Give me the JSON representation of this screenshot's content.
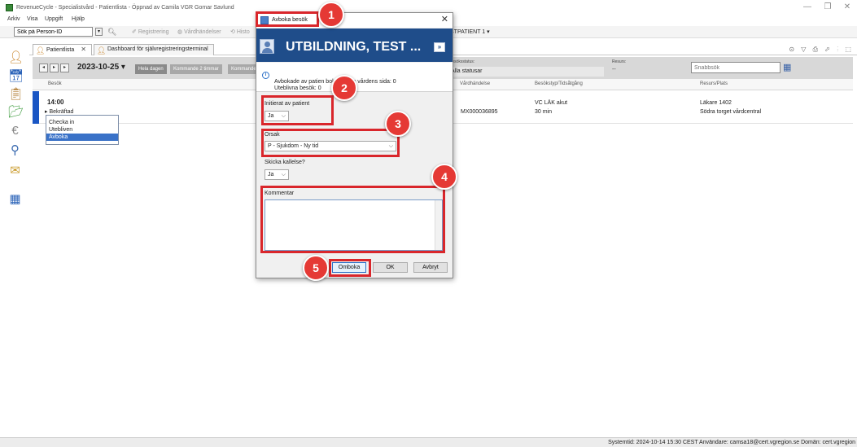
{
  "app": {
    "title": "RevenueCycle - Specialistvård - Patientlista - Öppnad av Camila VGR Gomar Savlund",
    "minimize": "—",
    "maximize": "❐",
    "close": "✕"
  },
  "menu": [
    "Arkiv",
    "Visa",
    "Uppgift",
    "Hjälp"
  ],
  "toolbar": {
    "person_search": "Sök på Person-ID",
    "registrering": "Registrering",
    "vardhandelser": "Vårdhändelser",
    "historik": "Histo",
    "patient_menu": "STPATIENT 1 ▾"
  },
  "tabs": [
    {
      "label": "Patientlista",
      "close": "✕"
    },
    {
      "label": "Dashboard för självregistreringsterminal"
    }
  ],
  "right_tools": "⊙ ▽ ⎙ ⬀ ⫶ ⬚",
  "filter": {
    "date": "2023-10-25 ▾",
    "hela_dagen": "Hela dagen",
    "kommande": "Kommande 2 timmar",
    "kommande_short": "Kommande",
    "status_label": "Besöksstatus:",
    "status_value": "Alla statusar",
    "resurs_label": "Resurs:",
    "resurs_value": "--",
    "snabbsok": "Snabbsök"
  },
  "columns": {
    "besok": "Besök",
    "vardhandelse": "Vårdhändelse",
    "besokstyp": "Besökstyp/Tidsåtgång",
    "resurs": "Resurs/Plats"
  },
  "row": {
    "time": "14:00",
    "status": "▸ Bekräftad",
    "vardhandelse": "MX000036895",
    "besokstyp": "VC LÄK akut",
    "tidsatgang": "30 min",
    "resurs": "Läkare 1402",
    "plats": "Södra torget vårdcentral"
  },
  "context_menu": [
    "Checka in",
    "Utebliven",
    "Avboka"
  ],
  "statusbar": "Systemtid: 2024-10-14 15:30 CEST Användare: camsa18@cert.vgregion.se Domän: cert.vgregion",
  "dialog": {
    "title": "Avboka besök",
    "close": "✕",
    "patient_name": "UTBILDNING, TEST ...",
    "expand": "»",
    "info_line1": "Avbokade av patien      bokade från vårdens sida: 0",
    "info_line2": "Uteblivna besök: 0",
    "initierat_label": "Initierat av patient",
    "initierat_value": "Ja",
    "orsak_label": "Orsak",
    "orsak_value": "P - Sjukdom - Ny tid",
    "kallelse_label": "Skicka kallelse?",
    "kallelse_value": "Ja",
    "kommentar_label": "Kommentar",
    "kommentar_value": "",
    "omboka": "Omboka",
    "ok": "OK",
    "avbryt": "Avbryt"
  },
  "callouts": [
    "1",
    "2",
    "3",
    "4",
    "5"
  ],
  "colors": {
    "callout": "#e53935",
    "dialog_header": "#1f4d8a",
    "row_marker": "#1a56c4",
    "selection": "#3a72c8"
  }
}
